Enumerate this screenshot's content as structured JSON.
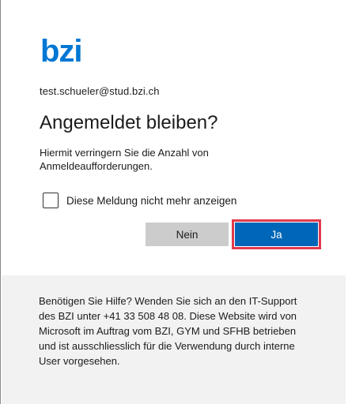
{
  "brand": {
    "logo_text": "bzi",
    "logo_color": "#0078d4"
  },
  "account": {
    "email": "test.schueler@stud.bzi.ch"
  },
  "dialog": {
    "title": "Angemeldet bleiben?",
    "description": "Hiermit verringern Sie die Anzahl von Anmeldeaufforderungen.",
    "checkbox_label": "Diese Meldung nicht mehr anzeigen",
    "checkbox_checked": false,
    "no_label": "Nein",
    "yes_label": "Ja"
  },
  "colors": {
    "primary_button": "#0067b8",
    "secondary_button": "#cccccc",
    "highlight": "#e13a4c"
  },
  "footer": {
    "help_text": "Benötigen Sie Hilfe? Wenden Sie sich an den IT-Support des BZI unter +41 33 508 48 08. Diese Website wird von Microsoft im Auftrag vom BZI, GYM und SFHB betrieben und ist ausschliesslich für die Verwendung durch interne User vorgesehen."
  }
}
